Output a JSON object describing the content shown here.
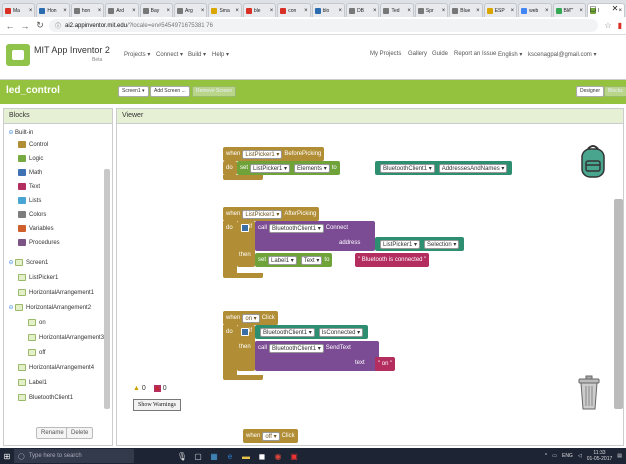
{
  "browser": {
    "tabs": [
      {
        "label": "Ma",
        "color": "#d93025"
      },
      {
        "label": "Hon",
        "color": "#2b6cb0"
      },
      {
        "label": "hon",
        "color": "#777"
      },
      {
        "label": "Ard",
        "color": "#777"
      },
      {
        "label": "Bay",
        "color": "#777"
      },
      {
        "label": "Arg",
        "color": "#777"
      },
      {
        "label": "Sma",
        "color": "#d9a700"
      },
      {
        "label": "ble",
        "color": "#d93025"
      },
      {
        "label": "con",
        "color": "#d93025"
      },
      {
        "label": "blo",
        "color": "#2b6cb0"
      },
      {
        "label": "DB",
        "color": "#777"
      },
      {
        "label": "Ted",
        "color": "#777"
      },
      {
        "label": "Spr",
        "color": "#777"
      },
      {
        "label": "Blue",
        "color": "#777"
      },
      {
        "label": "ESP",
        "color": "#d9a700"
      },
      {
        "label": "web",
        "color": "#4285f4"
      },
      {
        "label": "Ble",
        "color": "#34a853"
      },
      {
        "label": "I",
        "color": "#6fa33a"
      }
    ],
    "win_controls": [
      "–",
      "◻",
      "✕"
    ],
    "url_host": "ai2.appinventor.mit.edu",
    "url_path": "/?locale=en#5454971675381 76",
    "star_icon": "star-icon"
  },
  "header": {
    "title": "MIT App Inventor 2",
    "beta": "Beta",
    "menus": [
      "Projects ▾",
      "Connect ▾",
      "Build ▾",
      "Help ▾"
    ],
    "right_menus": [
      "My Projects",
      "Gallery",
      "Guide",
      "Report an Issue",
      "English ▾",
      "kscenagpal@gmail.com ▾"
    ]
  },
  "project": {
    "name": "led_control",
    "screen_button": "Screen1 ▾",
    "add_screen": "Add Screen ...",
    "remove_screen": "Remove Screen",
    "designer": "Designer",
    "blocks": "Blocks"
  },
  "blocks_panel": {
    "title": "Blocks",
    "builtin": "Built-in",
    "categories": [
      {
        "label": "Control",
        "color": "#b18e35"
      },
      {
        "label": "Logic",
        "color": "#77ab41"
      },
      {
        "label": "Math",
        "color": "#3f71b5"
      },
      {
        "label": "Text",
        "color": "#b32d5e"
      },
      {
        "label": "Lists",
        "color": "#49a6d4"
      },
      {
        "label": "Colors",
        "color": "#7d7d7d"
      },
      {
        "label": "Variables",
        "color": "#d05f2d"
      },
      {
        "label": "Procedures",
        "color": "#7c5385"
      }
    ],
    "components": [
      "Screen1",
      "ListPicker1",
      "HorizontalArrangement1",
      "HorizontalArrangement2",
      "on",
      "HorizontalArrangement3",
      "off",
      "HorizontalArrangement4",
      "Label1",
      "BluetoothClient1"
    ],
    "rename": "Rename",
    "delete": "Delete"
  },
  "viewer": {
    "title": "Viewer",
    "warnings_yellow": "0",
    "warnings_red": "0",
    "show_warnings": "Show Warnings"
  },
  "blocks_code": {
    "b1": {
      "when": "when",
      "comp": "ListPicker1 ▾",
      "event": "BeforePicking",
      "do": "do",
      "set": "set",
      "target": "ListPicker1 ▾",
      "prop": "Elements ▾",
      "to": "to",
      "src": "BluetoothClient1 ▾",
      "src_prop": "AddressesAndNames ▾"
    },
    "b2": {
      "when": "when",
      "comp": "ListPicker1 ▾",
      "event": "AfterPicking",
      "do": "do",
      "if": "if",
      "call": "call",
      "callcomp": "BluetoothClient1 ▾",
      "method": "Connect",
      "address": "address",
      "selcomp": "ListPicker1 ▾",
      "selprop": "Selection ▾",
      "then": "then",
      "set": "set",
      "label": "Label1 ▾",
      "prop": "Text ▾",
      "to": "to",
      "str": "\" Bluetooth is connected \""
    },
    "b3": {
      "when": "when",
      "comp": "on ▾",
      "event": "Click",
      "do": "do",
      "if": "if",
      "btcomp": "BluetoothClient1 ▾",
      "isconn": "IsConnected ▾",
      "then": "then",
      "call": "call",
      "callcomp": "BluetoothClient1 ▾",
      "method": "SendText",
      "text": "text",
      "str": "\" on \""
    },
    "b4": {
      "when": "when",
      "comp": "off ▾",
      "event": "Click"
    }
  },
  "taskbar": {
    "search": "Type here to search",
    "time": "11:33",
    "date": "01-05-2017"
  }
}
